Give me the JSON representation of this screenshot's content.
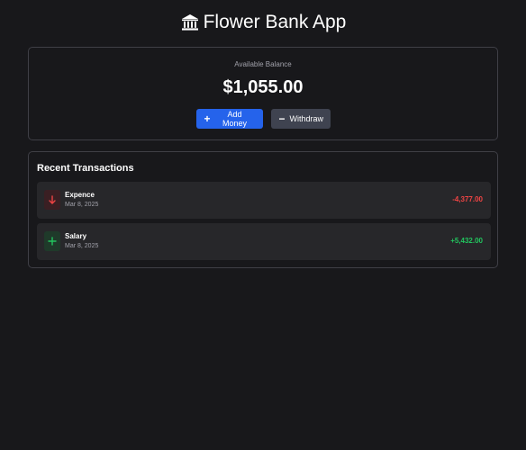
{
  "header": {
    "title": "Flower Bank App",
    "icon": "bank-icon"
  },
  "balance": {
    "label": "Available Balance",
    "amount": "$1,055.00",
    "add_label": "Add Money",
    "withdraw_label": "Withdraw"
  },
  "transactions": {
    "heading": "Recent Transactions",
    "items": [
      {
        "name": "Expence",
        "date": "Mar 8, 2025",
        "amount": "-4,377.00",
        "type": "debit",
        "icon": "arrow-down-icon",
        "color": "#ef4444"
      },
      {
        "name": "Salary",
        "date": "Mar 8, 2025",
        "amount": "+5,432.00",
        "type": "credit",
        "icon": "plus-icon",
        "color": "#22c55e"
      }
    ]
  },
  "colors": {
    "background": "#18181b",
    "primary": "#2563eb",
    "debit": "#ef4444",
    "credit": "#22c55e"
  }
}
